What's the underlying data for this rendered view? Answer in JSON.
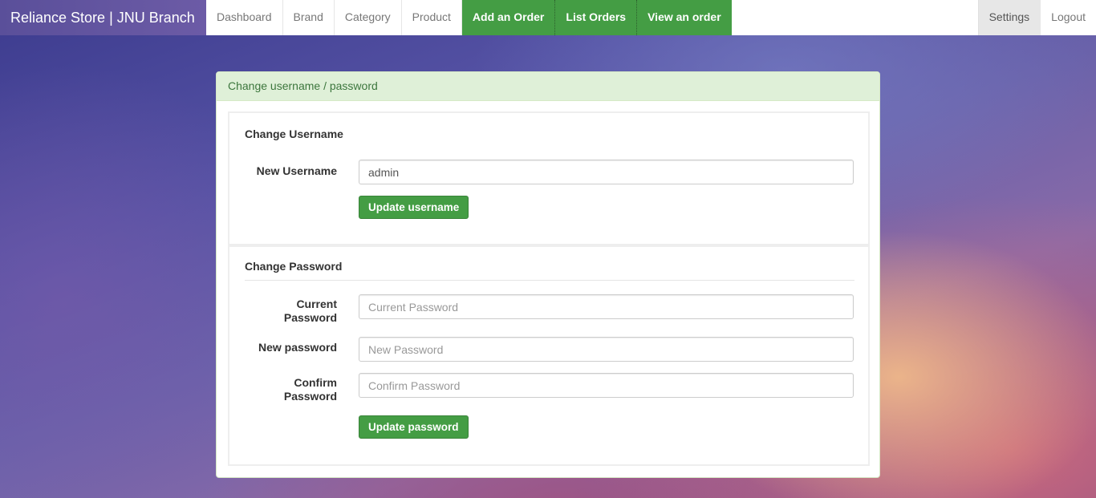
{
  "navbar": {
    "brand": "Reliance Store | JNU Branch",
    "items": [
      {
        "label": "Dashboard"
      },
      {
        "label": "Brand"
      },
      {
        "label": "Category"
      },
      {
        "label": "Product"
      },
      {
        "label": "Add an Order"
      },
      {
        "label": "List Orders"
      },
      {
        "label": "View an order"
      }
    ],
    "settings": "Settings",
    "logout": "Logout"
  },
  "panel": {
    "heading": "Change username / password",
    "username_section": {
      "title": "Change Username",
      "label": "New Username",
      "value": "admin",
      "button": "Update username"
    },
    "password_section": {
      "title": "Change Password",
      "current": {
        "label_line1": "Current",
        "label_line2": "Password",
        "placeholder": "Current Password"
      },
      "new": {
        "label": "New password",
        "placeholder": "New Password"
      },
      "confirm": {
        "label_line1": "Confirm",
        "label_line2": "Password",
        "placeholder": "Confirm Password"
      },
      "button": "Update password"
    }
  },
  "colors": {
    "nav_green": "#449d44",
    "panel_heading_bg": "#dff0d8",
    "panel_heading_text": "#3c763d"
  }
}
